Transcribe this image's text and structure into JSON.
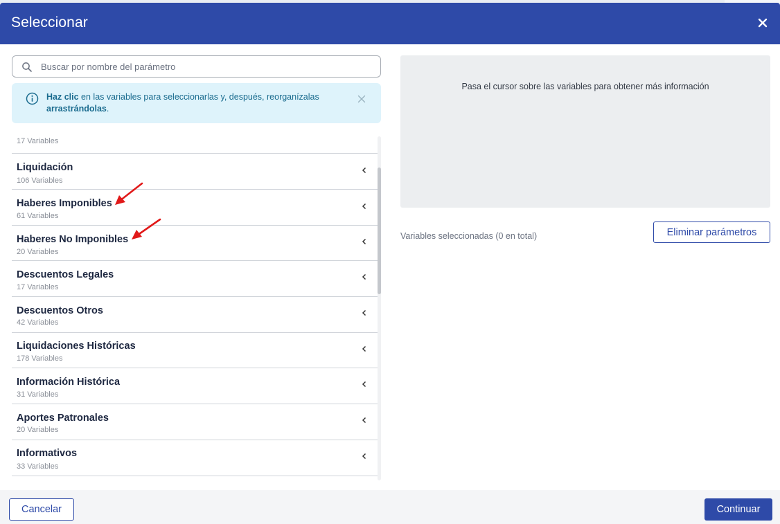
{
  "dialog": {
    "title": "Seleccionar",
    "close_icon": "close-icon"
  },
  "search": {
    "placeholder": "Buscar por nombre del parámetro",
    "value": "",
    "icon": "search-icon"
  },
  "info_banner": {
    "icon": "info-icon",
    "text_bold_1": "Haz clic",
    "text_1": " en las variables para seleccionarlas y, después, reorganízalas ",
    "text_bold_2": "arrastrándolas",
    "text_2": ".",
    "close_icon": "close-icon"
  },
  "categories": {
    "top_partial_count": "17 Variables",
    "items": [
      {
        "name": "Liquidación",
        "count": "106 Variables"
      },
      {
        "name": "Haberes Imponibles",
        "count": "61 Variables"
      },
      {
        "name": "Haberes No Imponibles",
        "count": "20 Variables"
      },
      {
        "name": "Descuentos Legales",
        "count": "17 Variables"
      },
      {
        "name": "Descuentos Otros",
        "count": "42 Variables"
      },
      {
        "name": "Liquidaciones Históricas",
        "count": "178 Variables"
      },
      {
        "name": "Información Histórica",
        "count": "31 Variables"
      },
      {
        "name": "Aportes Patronales",
        "count": "20 Variables"
      },
      {
        "name": "Informativos",
        "count": "33 Variables"
      }
    ]
  },
  "preview": {
    "hint": "Pasa el cursor sobre las variables para obtener más información"
  },
  "selected": {
    "label": "Variables seleccionadas (0 en total)",
    "remove_button": "Eliminar parámetros"
  },
  "footer": {
    "cancel_button": "Cancelar",
    "continue_button": "Continuar"
  },
  "colors": {
    "header": "#2e4aa8",
    "info_bg": "#def3fb",
    "info_text": "#1b6c8f",
    "annotation_arrow": "#e11919"
  }
}
